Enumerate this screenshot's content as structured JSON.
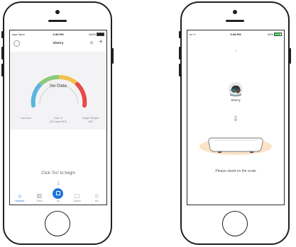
{
  "left_phone": {
    "status": {
      "carrier": "App Store",
      "time": "6:38 PM",
      "battery": "100%"
    },
    "header": {
      "username": "Sherry",
      "share_icon": "share-icon",
      "plus_label": "+"
    },
    "gauge": {
      "center_text": "No Data",
      "colors": [
        "#5ab4e0",
        "#8cc97a",
        "#f2c14e",
        "#e54b4b"
      ]
    },
    "metrics": [
      {
        "value": "- -",
        "label": "Last time"
      },
      {
        "value": "- -",
        "label": "Gain in\n(30 days/LBS)"
      },
      {
        "value": "- -",
        "label": "Target Weight\nLBS"
      }
    ],
    "prompt": "Click 'Go' to begin",
    "down_arrow": "↓",
    "tabs": [
      {
        "label": "Dynamic",
        "icon": "home-icon",
        "glyph": "⌂",
        "active": true
      },
      {
        "label": "Trend",
        "icon": "chart-icon",
        "glyph": "▥",
        "active": false
      },
      {
        "label": "Go",
        "icon": "scale-icon",
        "center": true
      },
      {
        "label": "Device",
        "icon": "device-icon",
        "glyph": "▢",
        "active": false
      },
      {
        "label": "Me",
        "icon": "me-icon",
        "glyph": "☺",
        "active": false
      }
    ]
  },
  "right_phone": {
    "status": {
      "carrier": "",
      "time": "6:38 PM",
      "battery": "92%"
    },
    "back_glyph": "‹",
    "username": "Sherry",
    "down_arrow": "⇩",
    "instruction": "Please stand on the scale"
  }
}
